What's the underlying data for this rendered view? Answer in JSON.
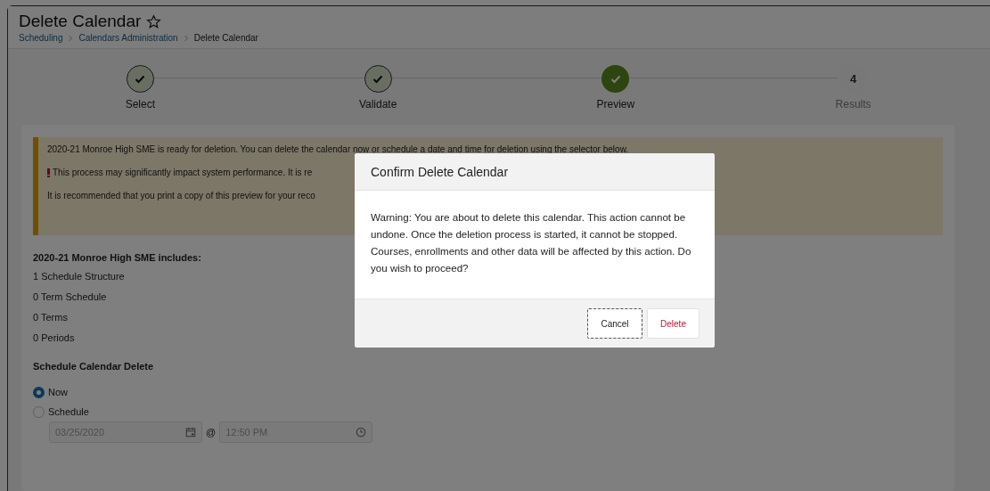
{
  "header": {
    "title": "Delete Calendar",
    "favorite": false,
    "breadcrumbs": [
      {
        "label": "Scheduling",
        "kind": "link"
      },
      {
        "label": "Calendars Administration",
        "kind": "link"
      },
      {
        "label": "Delete Calendar",
        "kind": "current"
      }
    ]
  },
  "steps": [
    {
      "label": "Select",
      "kind": "complete"
    },
    {
      "label": "Validate",
      "kind": "complete"
    },
    {
      "label": "Preview",
      "kind": "current"
    },
    {
      "label": "Results",
      "kind": "pending",
      "number": "4"
    }
  ],
  "warning": {
    "lines": [
      {
        "kind": "plain",
        "text": "2020-21 Monroe High SME is ready for deletion. You can delete the calendar now or schedule a date and time for deletion using the selector below."
      },
      {
        "kind": "alert",
        "text": "This process may significantly impact system performance. It is re"
      },
      {
        "kind": "plain",
        "text": "It is recommended that you print a copy of this preview for your reco"
      }
    ]
  },
  "includes": {
    "heading": "2020-21 Monroe High SME includes:",
    "items": [
      "1 Schedule Structure",
      "0 Term Schedule",
      "0 Terms",
      "0 Periods"
    ]
  },
  "schedule": {
    "heading": "Schedule Calendar Delete",
    "options": [
      {
        "label": "Now",
        "selected": true
      },
      {
        "label": "Schedule",
        "selected": false
      }
    ],
    "date": {
      "value": "03/25/2020",
      "disabled": true
    },
    "separator": "@",
    "time": {
      "value": "12:50 PM",
      "disabled": true
    }
  },
  "dialog": {
    "title": "Confirm Delete Calendar",
    "message": "Warning: You are about to delete this calendar. This action cannot be undone. Once the deletion process is started, it cannot be stopped. Courses, enrollments and other data will be affected by this action. Do you wish to proceed?",
    "buttons": [
      {
        "label": "Cancel",
        "kind": "secondary",
        "focused": true
      },
      {
        "label": "Delete",
        "kind": "danger",
        "focused": false
      }
    ]
  }
}
